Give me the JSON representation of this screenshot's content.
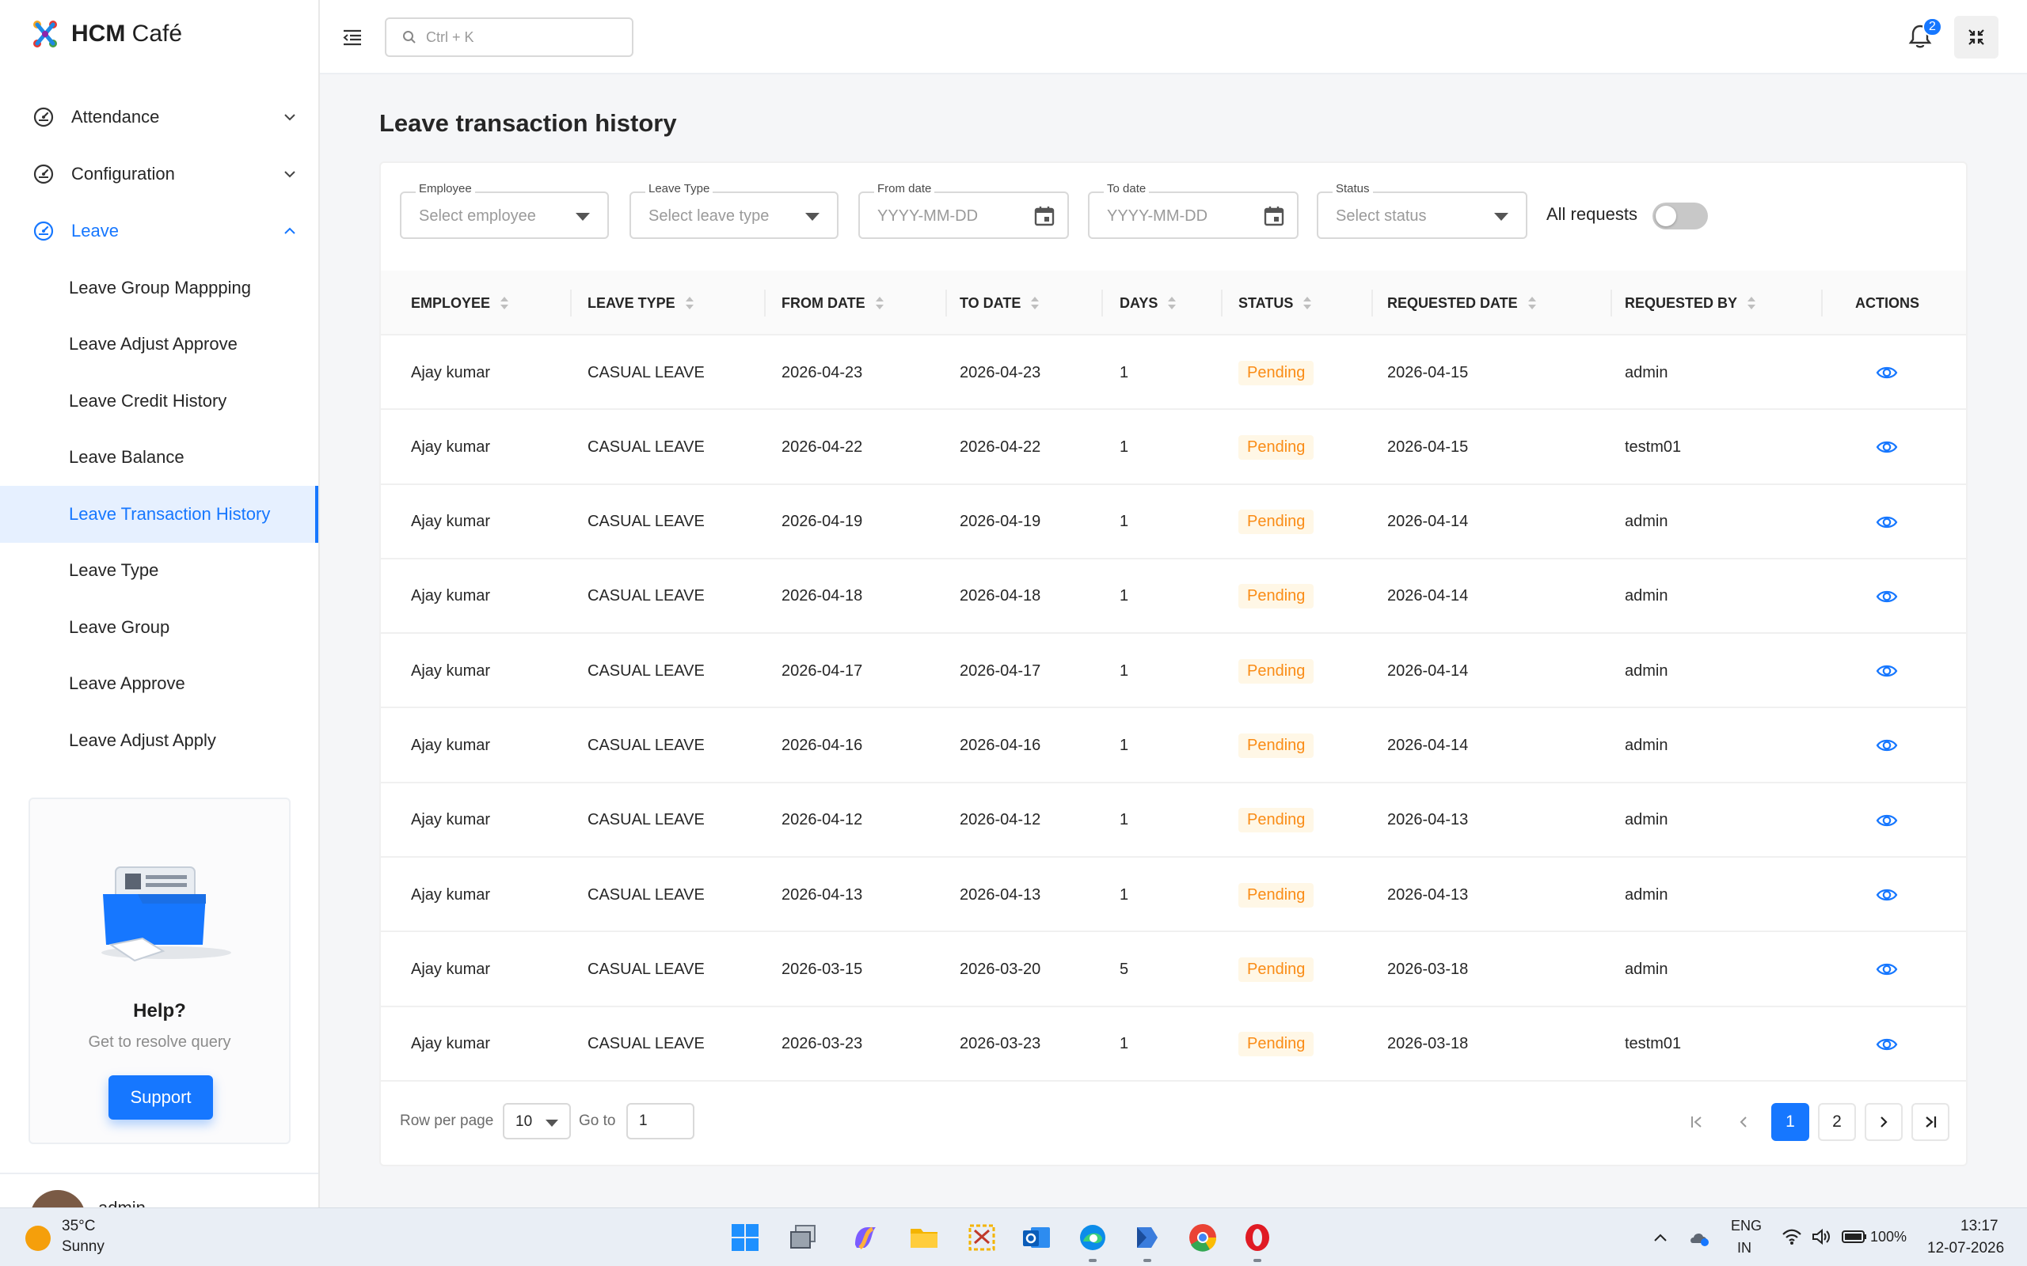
{
  "brand": {
    "name_bold": "HCM",
    "name_rest": " Café"
  },
  "sidebar": {
    "groups": [
      {
        "label": "Attendance",
        "icon": "dashboard-gauge-icon",
        "expanded": false
      },
      {
        "label": "Configuration",
        "icon": "dashboard-gauge-icon",
        "expanded": false
      },
      {
        "label": "Leave",
        "icon": "dashboard-gauge-icon",
        "expanded": true
      }
    ],
    "leave_items": [
      "Leave Group Mappping",
      "Leave Adjust Approve",
      "Leave Credit History",
      "Leave Balance",
      "Leave Transaction History",
      "Leave Type",
      "Leave Group",
      "Leave Approve",
      "Leave Adjust Apply"
    ],
    "active_item": "Leave Transaction History",
    "help": {
      "title": "Help?",
      "subtitle": "Get to resolve query",
      "button": "Support"
    },
    "user": {
      "name": "admin"
    }
  },
  "header": {
    "search_placeholder": "Ctrl + K",
    "notification_count": "2"
  },
  "page": {
    "title": "Leave transaction history"
  },
  "filters": {
    "employee": {
      "label": "Employee",
      "placeholder": "Select employee"
    },
    "leave_type": {
      "label": "Leave Type",
      "placeholder": "Select leave type"
    },
    "from_date": {
      "label": "From date",
      "placeholder": "YYYY-MM-DD"
    },
    "to_date": {
      "label": "To date",
      "placeholder": "YYYY-MM-DD"
    },
    "status": {
      "label": "Status",
      "placeholder": "Select status"
    },
    "all_requests": {
      "label": "All requests",
      "on": false
    }
  },
  "table": {
    "columns": [
      "EMPLOYEE",
      "LEAVE TYPE",
      "FROM DATE",
      "TO DATE",
      "DAYS",
      "STATUS",
      "REQUESTED DATE",
      "REQUESTED BY",
      "ACTIONS"
    ],
    "rows": [
      [
        "Ajay kumar",
        "CASUAL LEAVE",
        "2026-04-23",
        "2026-04-23",
        "1",
        "Pending",
        "2026-04-15",
        "admin"
      ],
      [
        "Ajay kumar",
        "CASUAL LEAVE",
        "2026-04-22",
        "2026-04-22",
        "1",
        "Pending",
        "2026-04-15",
        "testm01"
      ],
      [
        "Ajay kumar",
        "CASUAL LEAVE",
        "2026-04-19",
        "2026-04-19",
        "1",
        "Pending",
        "2026-04-14",
        "admin"
      ],
      [
        "Ajay kumar",
        "CASUAL LEAVE",
        "2026-04-18",
        "2026-04-18",
        "1",
        "Pending",
        "2026-04-14",
        "admin"
      ],
      [
        "Ajay kumar",
        "CASUAL LEAVE",
        "2026-04-17",
        "2026-04-17",
        "1",
        "Pending",
        "2026-04-14",
        "admin"
      ],
      [
        "Ajay kumar",
        "CASUAL LEAVE",
        "2026-04-16",
        "2026-04-16",
        "1",
        "Pending",
        "2026-04-14",
        "admin"
      ],
      [
        "Ajay kumar",
        "CASUAL LEAVE",
        "2026-04-12",
        "2026-04-12",
        "1",
        "Pending",
        "2026-04-13",
        "admin"
      ],
      [
        "Ajay kumar",
        "CASUAL LEAVE",
        "2026-04-13",
        "2026-04-13",
        "1",
        "Pending",
        "2026-04-13",
        "admin"
      ],
      [
        "Ajay kumar",
        "CASUAL LEAVE",
        "2026-03-15",
        "2026-03-20",
        "5",
        "Pending",
        "2026-03-18",
        "admin"
      ],
      [
        "Ajay kumar",
        "CASUAL LEAVE",
        "2026-03-23",
        "2026-03-23",
        "1",
        "Pending",
        "2026-03-18",
        "testm01"
      ]
    ]
  },
  "pagination": {
    "rows_per_page_label": "Row per page",
    "rows_per_page": "10",
    "goto_label": "Go to",
    "goto_value": "1",
    "pages": [
      "1",
      "2"
    ],
    "current_page": "1"
  },
  "taskbar": {
    "weather_temp": "35°C",
    "weather_condition": "Sunny",
    "apps": [
      "windows-start-icon",
      "task-view-icon",
      "copilot-icon",
      "file-explorer-icon",
      "snipping-tool-icon",
      "outlook-icon",
      "edge-icon",
      "power-automate-icon",
      "chrome-icon",
      "opera-icon"
    ],
    "lang_top": "ENG",
    "lang_bottom": "IN",
    "battery": "100%",
    "time": "13:17",
    "date": "12-07-2026"
  },
  "colors": {
    "accent": "#1677ff",
    "pending_text": "#fa8c16",
    "pending_bg": "#fff7e6",
    "active_bg": "#e6f0ff"
  }
}
